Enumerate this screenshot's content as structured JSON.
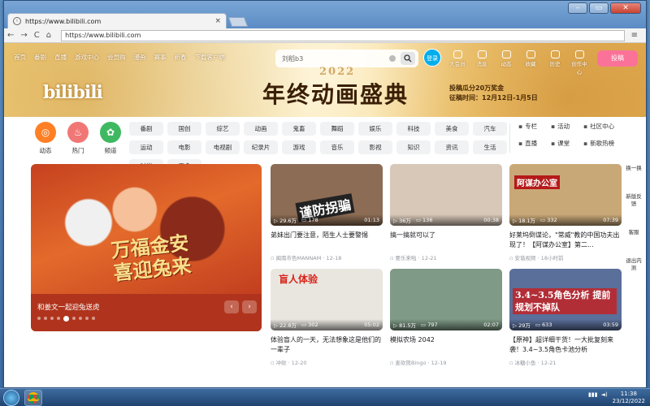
{
  "browser": {
    "tab_title": "https://www.bilibili.com",
    "tab_close": "×",
    "url": "https://www.bilibili.com",
    "back": "←",
    "forward": "→",
    "reload": "C",
    "home": "⌂",
    "menu": "≡",
    "window_controls": {
      "minimize": "–",
      "maximize": "▭",
      "close": "✕"
    }
  },
  "header": {
    "nav_items": [
      "首页",
      "番剧",
      "直播",
      "游戏中心",
      "会员购",
      "漫画",
      "赛事",
      "新春",
      "下载客户端"
    ],
    "search_placeholder": "刘稻b3",
    "login_label": "登录",
    "right_nav": [
      "大会员",
      "消息",
      "动态",
      "收藏",
      "历史",
      "创作中心"
    ],
    "upload_label": "投稿",
    "logo": "bilibili",
    "banner_year": "2022",
    "banner_title": "年终动画盛典",
    "prize_line1": "投稿瓜分20万奖金",
    "prize_line2": "征稿时间：12月12日-1月5日"
  },
  "channels": {
    "big_icons": [
      {
        "label": "动态",
        "color": "#ff7f24"
      },
      {
        "label": "热门",
        "color": "#f07775"
      },
      {
        "label": "频道",
        "color": "#3fb961"
      }
    ],
    "grid": [
      "番剧",
      "国创",
      "综艺",
      "动画",
      "鬼畜",
      "舞蹈",
      "娱乐",
      "科技",
      "美食",
      "汽车",
      "运动",
      "电影",
      "电视剧",
      "纪录片",
      "游戏",
      "音乐",
      "影视",
      "知识",
      "资讯",
      "生活",
      "时尚",
      "更多"
    ],
    "side": [
      "专栏",
      "活动",
      "社区中心",
      "直播",
      "课堂",
      "新歌热榜"
    ]
  },
  "carousel": {
    "title": "和姜文一起迎兔送虎",
    "art_text": "万福金安\n喜迎兔来",
    "slides": 9,
    "active": 4,
    "prev": "‹",
    "next": "›"
  },
  "videos": [
    {
      "title": "弟妹出门要注意，陌生人士要警惕",
      "views": "29.6万",
      "comments": "178",
      "duration": "01:13",
      "uploader": "闽南市色MANNAM · 12-18",
      "overlay": "谨防拐骗",
      "bg": "#8c6c54"
    },
    {
      "title": "搞一搞就可以了",
      "views": "36万",
      "comments": "136",
      "duration": "00:38",
      "uploader": "要乐来啦 · 12-21",
      "overlay": "",
      "bg": "#d8c8b8"
    },
    {
      "title": "好莱坞倒谍论，\"常威\"教的中国功夫出现了！【阿谋办公室】第二...",
      "views": "18.1万",
      "comments": "332",
      "duration": "07:39",
      "uploader": "安谐视频 · 18小时前",
      "overlay": "阿谋办公室",
      "bg": "#c9a878"
    },
    {
      "title": "体验盲人的一天，无法想象这是他们的一辈子",
      "views": "22.8万",
      "comments": "302",
      "duration": "05:02",
      "uploader": "冲砍 · 12-20",
      "overlay": "盲人体验",
      "bg": "#e9e6df"
    },
    {
      "title": "模拟农场 2042",
      "views": "81.5万",
      "comments": "797",
      "duration": "02:07",
      "uploader": "麦砍熊Bingo · 12-19",
      "overlay": "",
      "bg": "#7f9a86"
    },
    {
      "title": "【原神】超详细干货！一大批复刻来袭！3.4~3.5角色卡池分析",
      "views": "29万",
      "comments": "633",
      "duration": "03:59",
      "uploader": "冰糖小鱼 · 12-21",
      "overlay": "3.4~3.5角色分析 提前规划不掉队",
      "bg": "#5a6f9a"
    }
  ],
  "right_tools": [
    "换一换",
    "新版反馈",
    "客服",
    "退出内测"
  ],
  "taskbar": {
    "time": "11:38",
    "date": "23/12/2022"
  }
}
